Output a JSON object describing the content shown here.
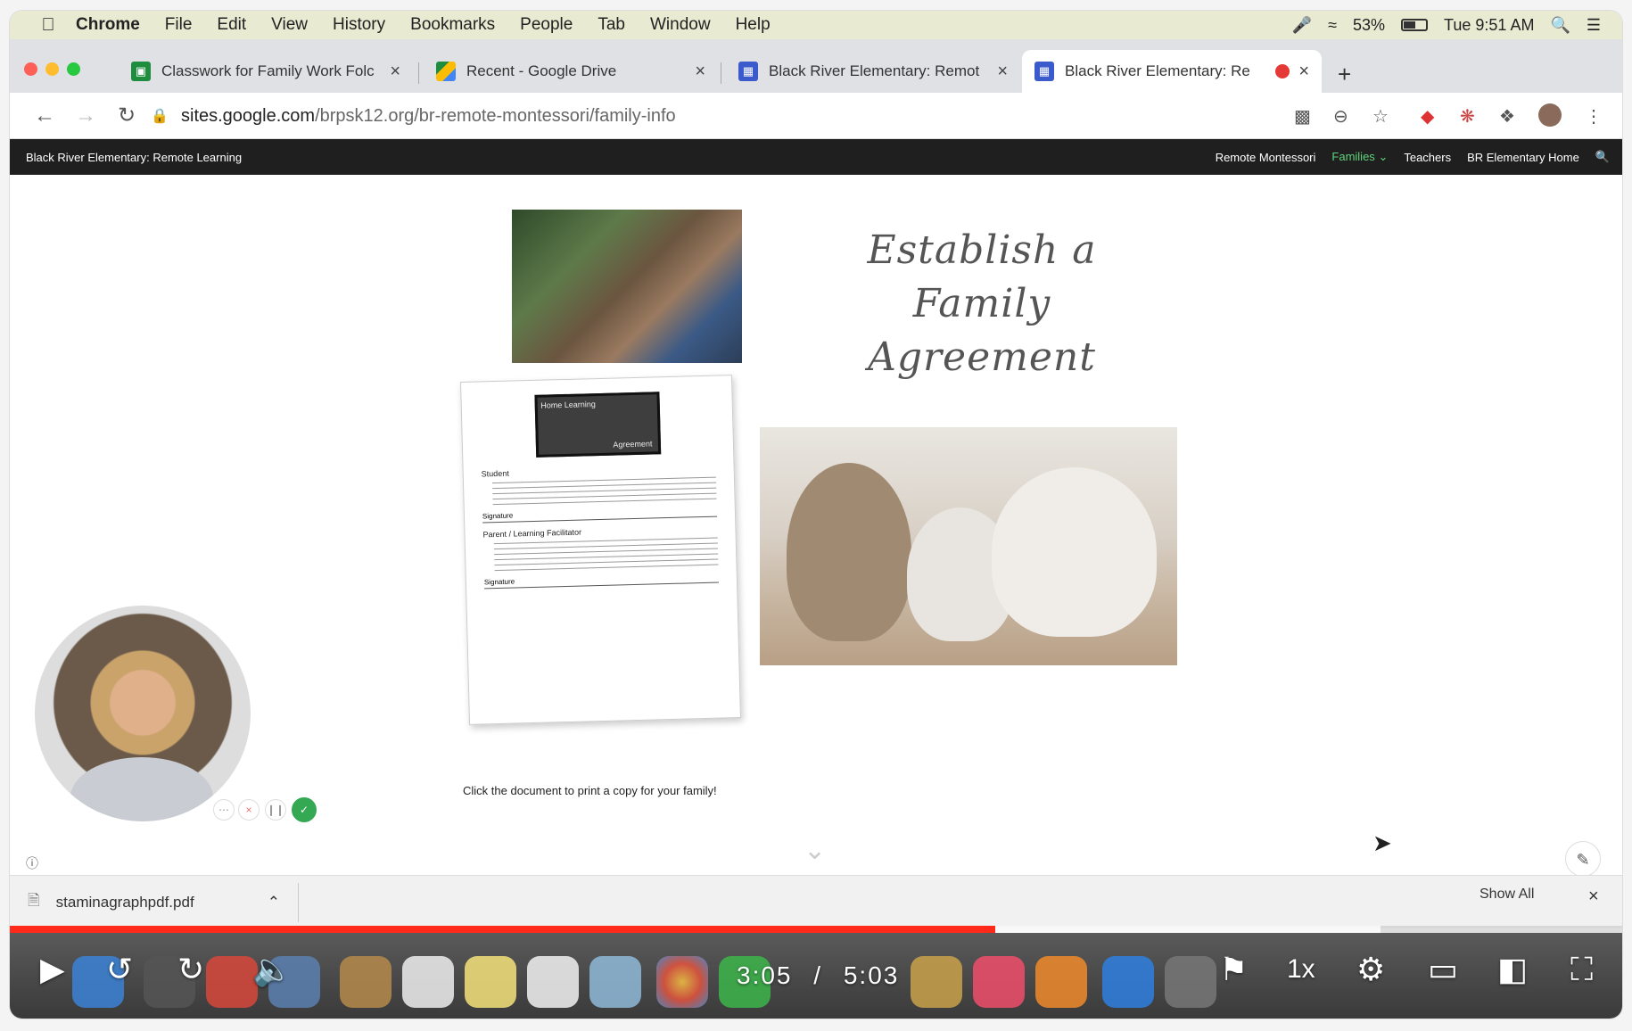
{
  "menubar": {
    "app": "Chrome",
    "items": [
      "File",
      "Edit",
      "View",
      "History",
      "Bookmarks",
      "People",
      "Tab",
      "Window",
      "Help"
    ],
    "battery": "53%",
    "clock": "Tue 9:51 AM"
  },
  "tabs": [
    {
      "title": "Classwork for Family Work Folc",
      "favicon_color": "#1e8e3e"
    },
    {
      "title": "Recent - Google Drive",
      "favicon_color": "#fbbc04"
    },
    {
      "title": "Black River Elementary: Remot",
      "favicon_color": "#3b5bcc"
    },
    {
      "title": "Black River Elementary: Re",
      "favicon_color": "#3b5bcc"
    }
  ],
  "omnibox": {
    "host": "sites.google.com",
    "path": "/brpsk12.org/br-remote-montessori/family-info"
  },
  "site": {
    "title": "Black River Elementary: Remote Learning",
    "nav": [
      "Remote Montessori",
      "Families",
      "Teachers",
      "BR Elementary Home"
    ],
    "active_nav_color": "#5fd27a"
  },
  "content": {
    "heading_line1": "Establish a",
    "heading_line2": "Family Agreement",
    "doc_badge_top": "Home Learning",
    "doc_badge_bottom": "Agreement",
    "doc_section1": "Student",
    "doc_section2": "Parent / Learning Facilitator",
    "doc_signature": "Signature",
    "caption": "Click the document to print a copy for your family!"
  },
  "downloads": {
    "filename": "staminagraphpdf.pdf",
    "show_all": "Show All"
  },
  "player": {
    "current_time": "3:05",
    "separator": "/",
    "duration": "5:03",
    "speed": "1x",
    "progress_fraction": 0.611,
    "buffer_fraction": 0.85
  },
  "icons": {
    "accent": "#ff2a1a"
  }
}
